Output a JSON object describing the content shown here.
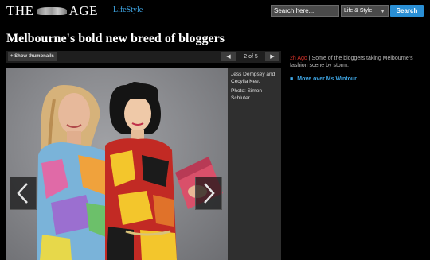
{
  "header": {
    "logo_left": "THE",
    "logo_right": "AGE",
    "section": "LifeStyle",
    "search_placeholder": "Search here...",
    "search_scope": "Life & Style",
    "search_button": "Search"
  },
  "article": {
    "headline": "Melbourne's bold new breed of bloggers"
  },
  "gallery": {
    "show_thumbnails": "+ Show thumbnails",
    "counter": "2 of 5",
    "prev_symbol": "◀",
    "next_symbol": "▶",
    "caption_names": "Jess Dempsey and Cecylia Kee.",
    "caption_credit": "Photo: Simon Schluter"
  },
  "sidebar": {
    "summary_time": "2h Ago",
    "summary_sep": "|",
    "summary_text": "Some of the bloggers taking Melbourne's fashion scene by storm.",
    "related_link": "Move over Ms Wintour"
  },
  "colors": {
    "accent": "#2a8fd5",
    "link": "#3fa7e6",
    "timestamp": "#d8322a"
  }
}
